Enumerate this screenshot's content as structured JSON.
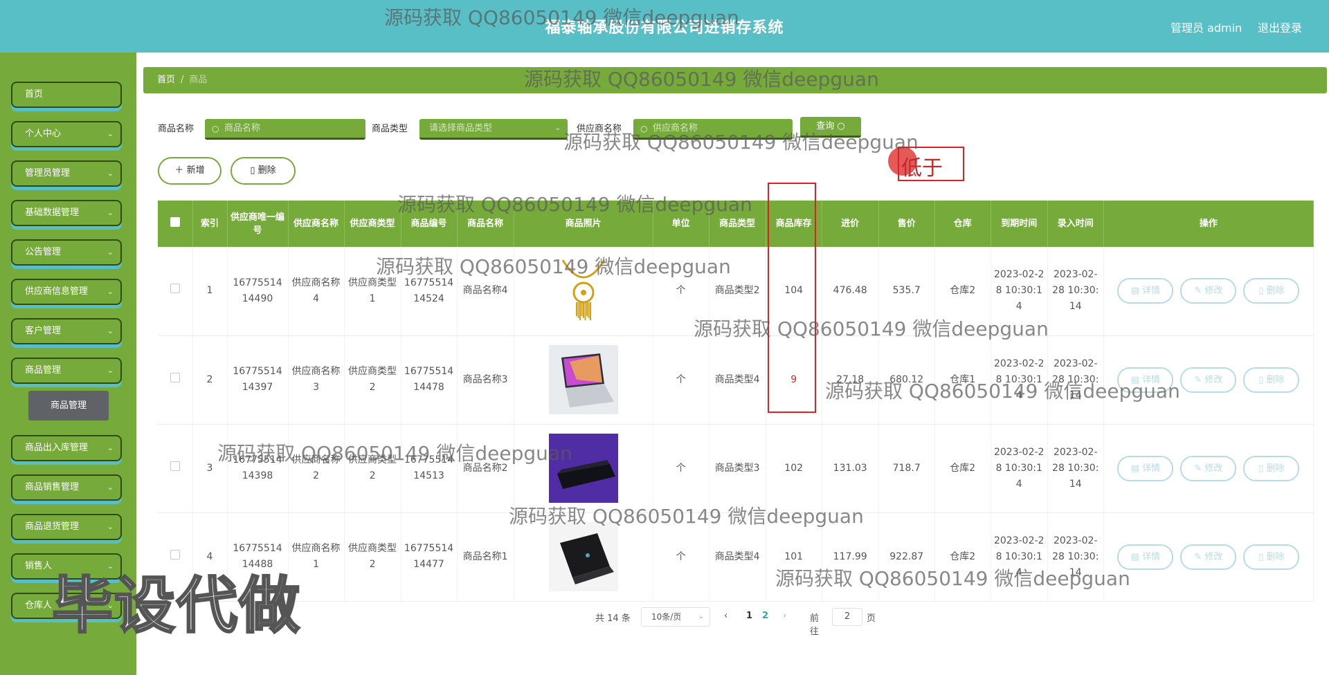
{
  "header": {
    "title": "福泰轴承股份有限公司进销存系统",
    "admin_label": "管理员 admin",
    "logout_label": "退出登录"
  },
  "sidebar": {
    "items": [
      {
        "label": "首页",
        "has_chevron": false
      },
      {
        "label": "个人中心",
        "has_chevron": true
      },
      {
        "label": "管理员管理",
        "has_chevron": true
      },
      {
        "label": "基础数据管理",
        "has_chevron": true
      },
      {
        "label": "公告管理",
        "has_chevron": true
      },
      {
        "label": "供应商信息管理",
        "has_chevron": true
      },
      {
        "label": "客户管理",
        "has_chevron": true
      },
      {
        "label": "商品管理",
        "has_chevron": true
      },
      {
        "label": "商品出入库管理",
        "has_chevron": true
      },
      {
        "label": "商品销售管理",
        "has_chevron": true
      },
      {
        "label": "商品退货管理",
        "has_chevron": true
      },
      {
        "label": "销售人",
        "has_chevron": true
      },
      {
        "label": "仓库人",
        "has_chevron": true
      }
    ],
    "active_submenu": "商品管理"
  },
  "breadcrumb": {
    "home": "首页",
    "separator": "/",
    "current": "商品"
  },
  "search": {
    "name_label": "商品名称",
    "name_placeholder": "商品名称",
    "type_label": "商品类型",
    "type_placeholder": "请选择商品类型",
    "supplier_label": "供应商名称",
    "supplier_placeholder": "供应商名称",
    "query_label": "查询"
  },
  "actions": {
    "add_label": "新增",
    "delete_label": "删除"
  },
  "annotation": {
    "text": "低于"
  },
  "table": {
    "headers": [
      "索引",
      "供应商唯一编号",
      "供应商名称",
      "供应商类型",
      "商品编号",
      "商品名称",
      "商品照片",
      "单位",
      "商品类型",
      "商品库存",
      "进价",
      "售价",
      "仓库",
      "到期时间",
      "录入时间",
      "操作"
    ],
    "rows": [
      {
        "index": "1",
        "supplier_no": "1677551414490",
        "supplier_name": "供应商名称4",
        "supplier_type": "供应商类型1",
        "product_no": "1677551414524",
        "product_name": "商品名称4",
        "photo": "gold-necklace",
        "unit": "个",
        "product_type": "商品类型2",
        "stock": "104",
        "cost": "476.48",
        "price": "535.7",
        "warehouse": "仓库2",
        "expire": "2023-02-28 10:30:14",
        "created": "2023-02-28 10:30:14",
        "low_stock": false
      },
      {
        "index": "2",
        "supplier_no": "1677551414397",
        "supplier_name": "供应商名称3",
        "supplier_type": "供应商类型2",
        "product_no": "1677551414478",
        "product_name": "商品名称3",
        "photo": "laptop-silver",
        "unit": "个",
        "product_type": "商品类型4",
        "stock": "9",
        "cost": "27.18",
        "price": "680.12",
        "warehouse": "仓库1",
        "expire": "2023-02-28 10:30:14",
        "created": "2023-02-28 10:30:14",
        "low_stock": true
      },
      {
        "index": "3",
        "supplier_no": "1677551414398",
        "supplier_name": "供应商名称2",
        "supplier_type": "供应商类型2",
        "product_no": "1677551414513",
        "product_name": "商品名称2",
        "photo": "laptop-dark-purple",
        "unit": "个",
        "product_type": "商品类型3",
        "stock": "102",
        "cost": "131.03",
        "price": "718.7",
        "warehouse": "仓库2",
        "expire": "2023-02-28 10:30:14",
        "created": "2023-02-28 10:30:14",
        "low_stock": false
      },
      {
        "index": "4",
        "supplier_no": "1677551414488",
        "supplier_name": "供应商名称1",
        "supplier_type": "供应商类型2",
        "product_no": "1677551414477",
        "product_name": "商品名称1",
        "photo": "laptop-black",
        "unit": "个",
        "product_type": "商品类型4",
        "stock": "101",
        "cost": "117.99",
        "price": "922.87",
        "warehouse": "仓库2",
        "expire": "2023-02-28 10:30:14",
        "created": "2023-02-28 10:30:14",
        "low_stock": false
      }
    ],
    "op_labels": {
      "detail": "详情",
      "edit": "修改",
      "delete": "删除"
    }
  },
  "pager": {
    "total": "共 14 条",
    "page_size": "10条/页",
    "pages": [
      "1",
      "2"
    ],
    "current": "2",
    "goto_label": "前往",
    "page_input": "2",
    "page_suffix": "页"
  },
  "watermarks": {
    "text": "源码获取 QQ86050149 微信deepguan",
    "big": "毕设代做"
  },
  "colors": {
    "header": "#58bfc7",
    "sidebar": "#76ab3c",
    "accent": "#76ab3c",
    "alert": "#e02020"
  }
}
